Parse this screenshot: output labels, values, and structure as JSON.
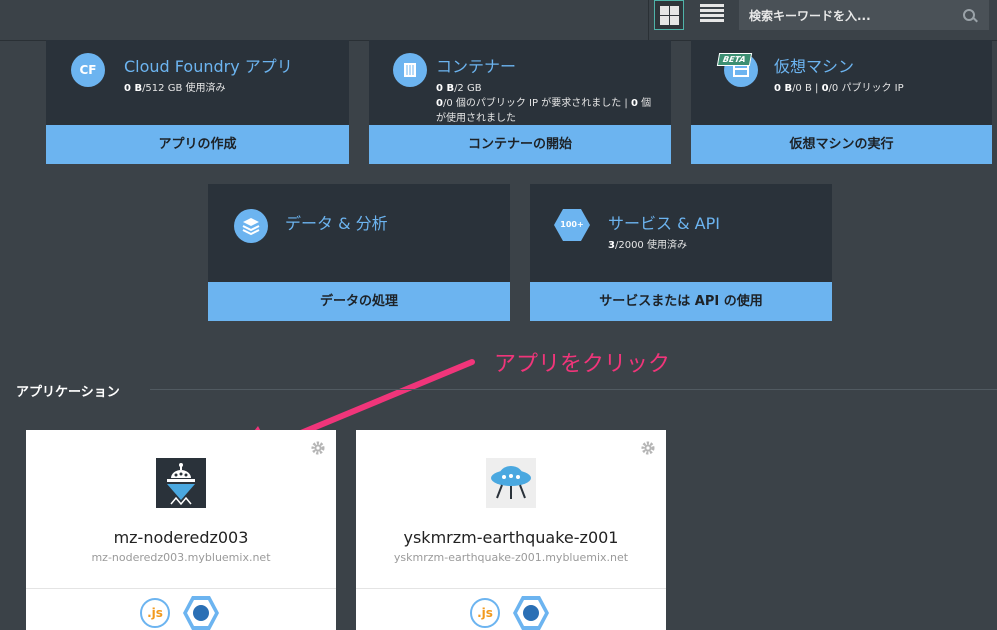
{
  "search": {
    "placeholder": "検索キーワードを入..."
  },
  "tiles": {
    "cf": {
      "icon_text": "CF",
      "title": "Cloud Foundry アプリ",
      "usage_value": "0 B",
      "usage_rest": "/512 GB 使用済み",
      "action": "アプリの作成"
    },
    "containers": {
      "title": "コンテナー",
      "usage_value": "0 B",
      "usage_rest": "/2 GB",
      "ip_line_a": "0",
      "ip_line_b": "/0 個のパブリック IP が要求されました | ",
      "ip_line_c": "0",
      "ip_line_d": " 個",
      "ip_line_e": "が使用されました",
      "action": "コンテナーの開始"
    },
    "vm": {
      "badge": "BETA",
      "title": "仮想マシン",
      "usage_a": "0 B",
      "usage_b": "/0 B  |  ",
      "usage_c": "0",
      "usage_d": "/0 パブリック IP",
      "action": "仮想マシンの実行"
    },
    "data": {
      "title": "データ & 分析",
      "action": "データの処理"
    },
    "services": {
      "icon_text": "100+",
      "title": "サービス & API",
      "usage_value": "3",
      "usage_rest": "/2000 使用済み",
      "action": "サービスまたは API の使用"
    }
  },
  "annotation": {
    "text": "アプリをクリック",
    "color": "#f0357a"
  },
  "applications": {
    "section_title": "アプリケーション",
    "items": [
      {
        "name": "mz-noderedz003",
        "url": "mz-noderedz003.mybluemix.net",
        "runtime_badge": ".js"
      },
      {
        "name": "yskmrzm-earthquake-z001",
        "url": "yskmrzm-earthquake-z001.mybluemix.net",
        "runtime_badge": ".js"
      }
    ]
  },
  "colors": {
    "accent": "#6cb4f0",
    "tile_bg": "#2a323a",
    "page_bg": "#3b4248"
  }
}
